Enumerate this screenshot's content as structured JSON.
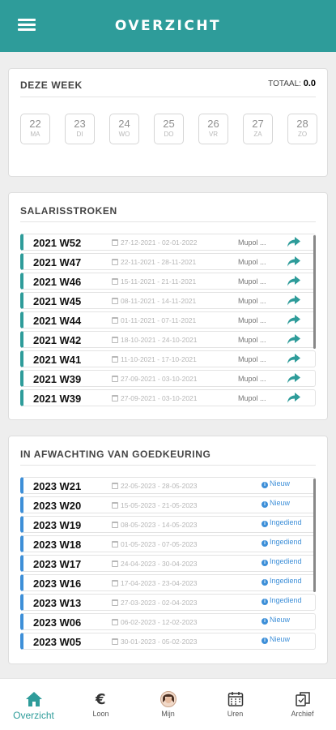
{
  "header": {
    "title": "OVERZICHT",
    "menu_icon": "hamburger-menu-icon"
  },
  "week": {
    "title": "DEZE WEEK",
    "total_label": "TOTAAL:",
    "total_value": "0.0",
    "days": [
      {
        "num": "22",
        "abbr": "MA"
      },
      {
        "num": "23",
        "abbr": "DI"
      },
      {
        "num": "24",
        "abbr": "WO"
      },
      {
        "num": "25",
        "abbr": "DO"
      },
      {
        "num": "26",
        "abbr": "VR"
      },
      {
        "num": "27",
        "abbr": "ZA"
      },
      {
        "num": "28",
        "abbr": "ZO"
      }
    ]
  },
  "salaris": {
    "title": "SALARISSTROKEN",
    "accent": "#2e9c9a",
    "items": [
      {
        "title": "2021 W52",
        "dates": "27-12-2021 - 02-01-2022",
        "company": "Mupol ..."
      },
      {
        "title": "2021 W47",
        "dates": "22-11-2021 - 28-11-2021",
        "company": "Mupol ..."
      },
      {
        "title": "2021 W46",
        "dates": "15-11-2021 - 21-11-2021",
        "company": "Mupol ..."
      },
      {
        "title": "2021 W45",
        "dates": "08-11-2021 - 14-11-2021",
        "company": "Mupol ..."
      },
      {
        "title": "2021 W44",
        "dates": "01-11-2021 - 07-11-2021",
        "company": "Mupol ..."
      },
      {
        "title": "2021 W42",
        "dates": "18-10-2021 - 24-10-2021",
        "company": "Mupol ..."
      },
      {
        "title": "2021 W41",
        "dates": "11-10-2021 - 17-10-2021",
        "company": "Mupol ..."
      },
      {
        "title": "2021 W39",
        "dates": "27-09-2021 - 03-10-2021",
        "company": "Mupol ..."
      },
      {
        "title": "2021 W39",
        "dates": "27-09-2021 - 03-10-2021",
        "company": "Mupol ..."
      }
    ]
  },
  "pending": {
    "title": "IN AFWACHTING VAN GOEDKEURING",
    "accent": "#3d8fd8",
    "items": [
      {
        "title": "2023 W21",
        "dates": "22-05-2023 - 28-05-2023",
        "status": "Nieuw"
      },
      {
        "title": "2023 W20",
        "dates": "15-05-2023 - 21-05-2023",
        "status": "Nieuw"
      },
      {
        "title": "2023 W19",
        "dates": "08-05-2023 - 14-05-2023",
        "status": "Ingediend"
      },
      {
        "title": "2023 W18",
        "dates": "01-05-2023 - 07-05-2023",
        "status": "Ingediend"
      },
      {
        "title": "2023 W17",
        "dates": "24-04-2023 - 30-04-2023",
        "status": "Ingediend"
      },
      {
        "title": "2023 W16",
        "dates": "17-04-2023 - 23-04-2023",
        "status": "Ingediend"
      },
      {
        "title": "2023 W13",
        "dates": "27-03-2023 - 02-04-2023",
        "status": "Ingediend"
      },
      {
        "title": "2023 W06",
        "dates": "06-02-2023 - 12-02-2023",
        "status": "Nieuw"
      },
      {
        "title": "2023 W05",
        "dates": "30-01-2023 - 05-02-2023",
        "status": "Nieuw"
      }
    ]
  },
  "nav": {
    "items": [
      {
        "label": "Overzicht",
        "icon": "home-icon",
        "active": true
      },
      {
        "label": "Loon",
        "icon": "euro-icon"
      },
      {
        "label": "Mijn",
        "icon": "avatar-icon"
      },
      {
        "label": "Uren",
        "icon": "calendar-icon"
      },
      {
        "label": "Archief",
        "icon": "archive-icon"
      }
    ]
  }
}
